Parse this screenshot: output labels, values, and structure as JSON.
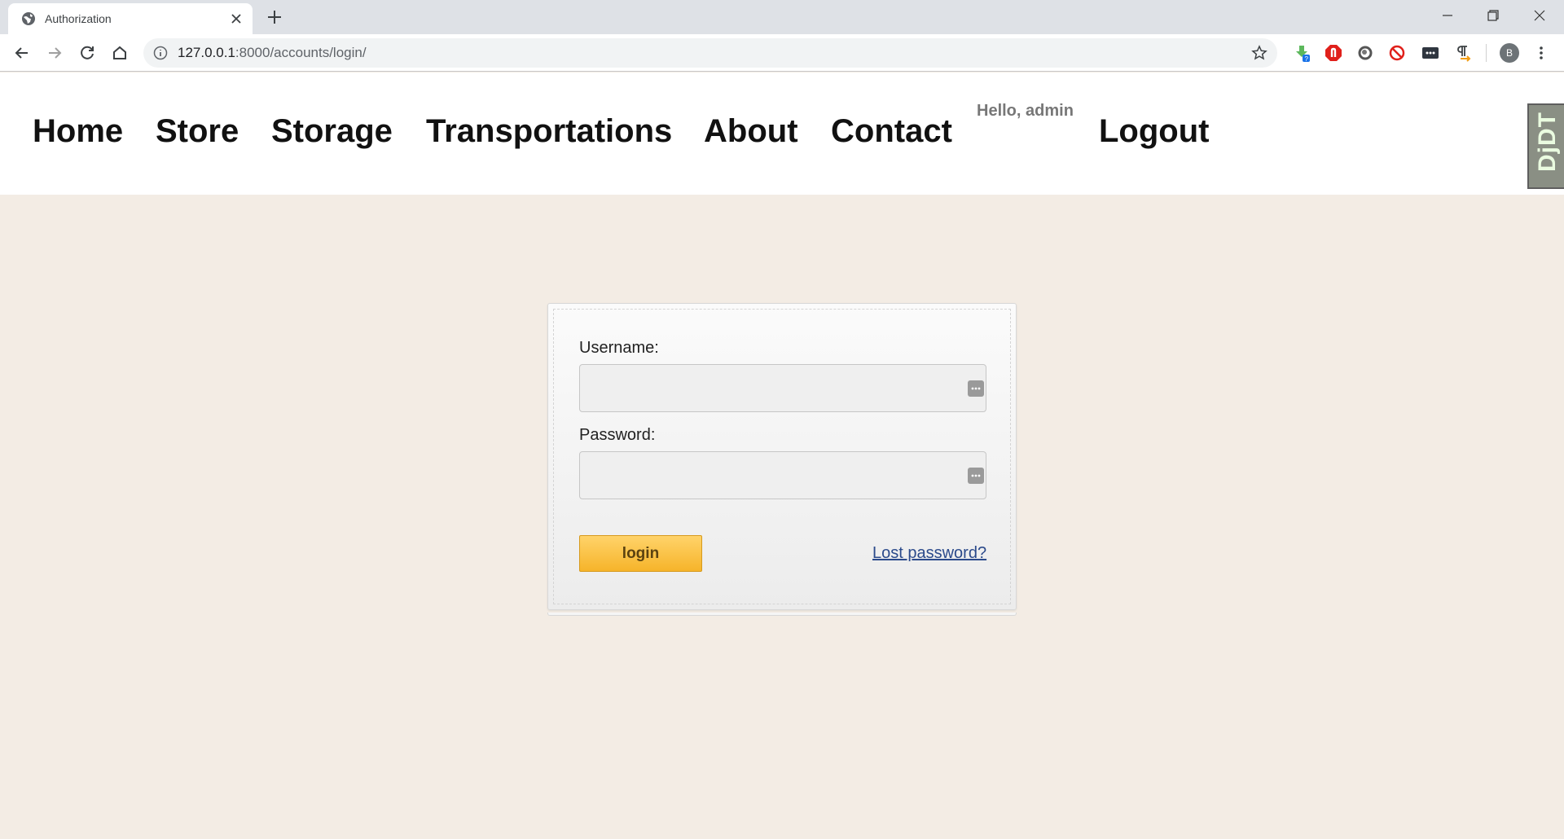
{
  "browser": {
    "tab_title": "Authorization",
    "url_host": "127.0.0.1",
    "url_rest": ":8000/accounts/login/",
    "profile_initial": "B"
  },
  "nav": {
    "links": [
      "Home",
      "Store",
      "Storage",
      "Transportations",
      "About",
      "Contact"
    ],
    "greeting": "Hello, admin",
    "logout": "Logout"
  },
  "debug_toolbar": {
    "label": "DjDT"
  },
  "login_form": {
    "username_label": "Username:",
    "username_value": "",
    "password_label": "Password:",
    "password_value": "",
    "submit_label": "login",
    "lost_password": "Lost password?"
  },
  "colors": {
    "page_background": "#f3ece4",
    "button": "#f6b42a",
    "link": "#2b4a8b"
  }
}
